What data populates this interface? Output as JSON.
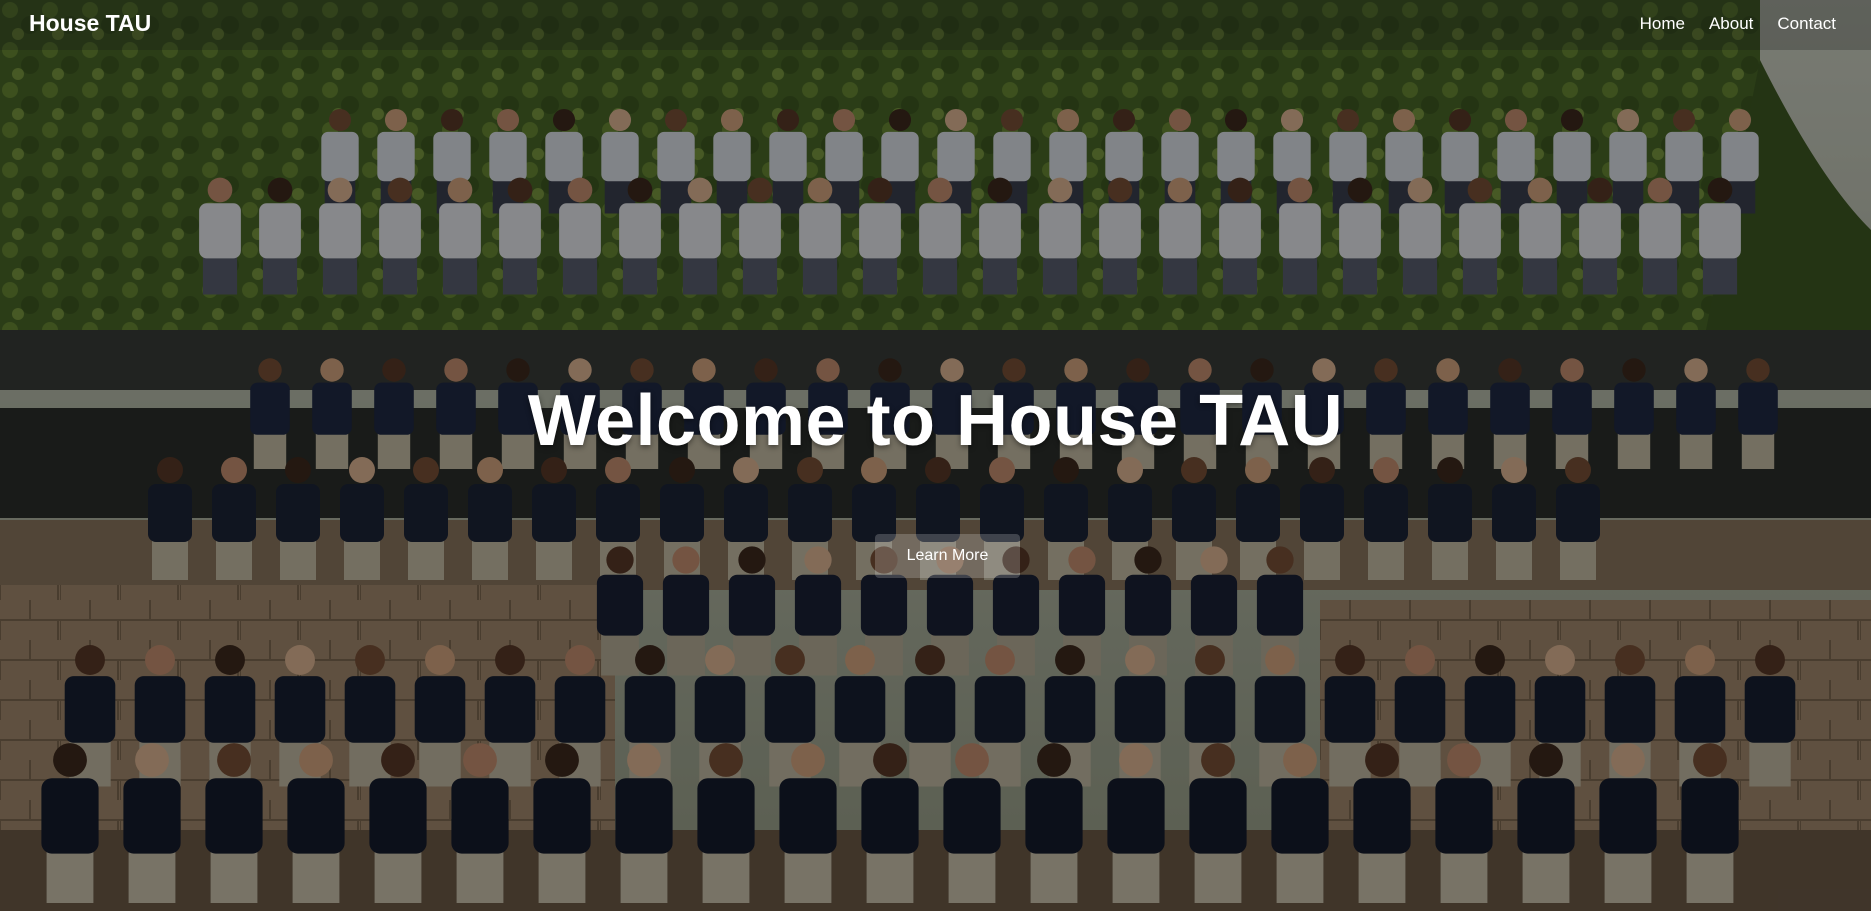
{
  "navbar": {
    "brand": "House TAU",
    "links": [
      {
        "label": "Home"
      },
      {
        "label": "About"
      },
      {
        "label": "Contact"
      }
    ]
  },
  "hero": {
    "title": "Welcome to House TAU",
    "cta_label": "Learn More"
  },
  "colors": {
    "text": "#ffffff",
    "uniform_navy": "#1c2538",
    "foliage": "#4f6b2a",
    "stone_wall": "#9d8468"
  }
}
